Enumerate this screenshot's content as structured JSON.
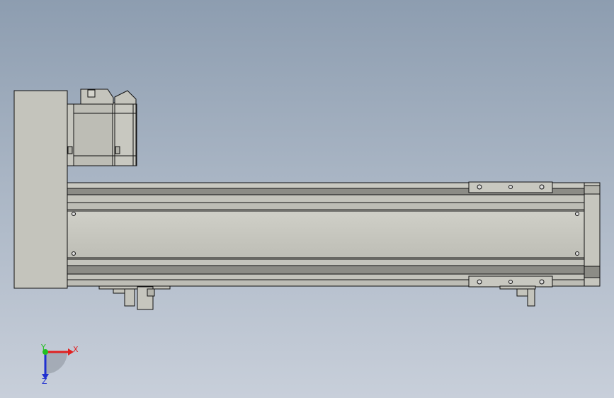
{
  "view": {
    "background_top": "#8d9db0",
    "background_bottom": "#c8cfda",
    "part_fill": "#c4c4bc",
    "part_shade": "#a9a9a2",
    "part_dark": "#8c8c86",
    "edge_color": "#111111"
  },
  "triad": {
    "x_label": "X",
    "y_label": "Y",
    "z_label": "Z",
    "x_color": "#e02020",
    "y_color": "#20c020",
    "z_color": "#2030d0"
  },
  "model": {
    "components": [
      "end-plate",
      "servo-motor",
      "linear-rail-body",
      "carriage-top",
      "carriage-bottom",
      "limit-sensors"
    ]
  }
}
